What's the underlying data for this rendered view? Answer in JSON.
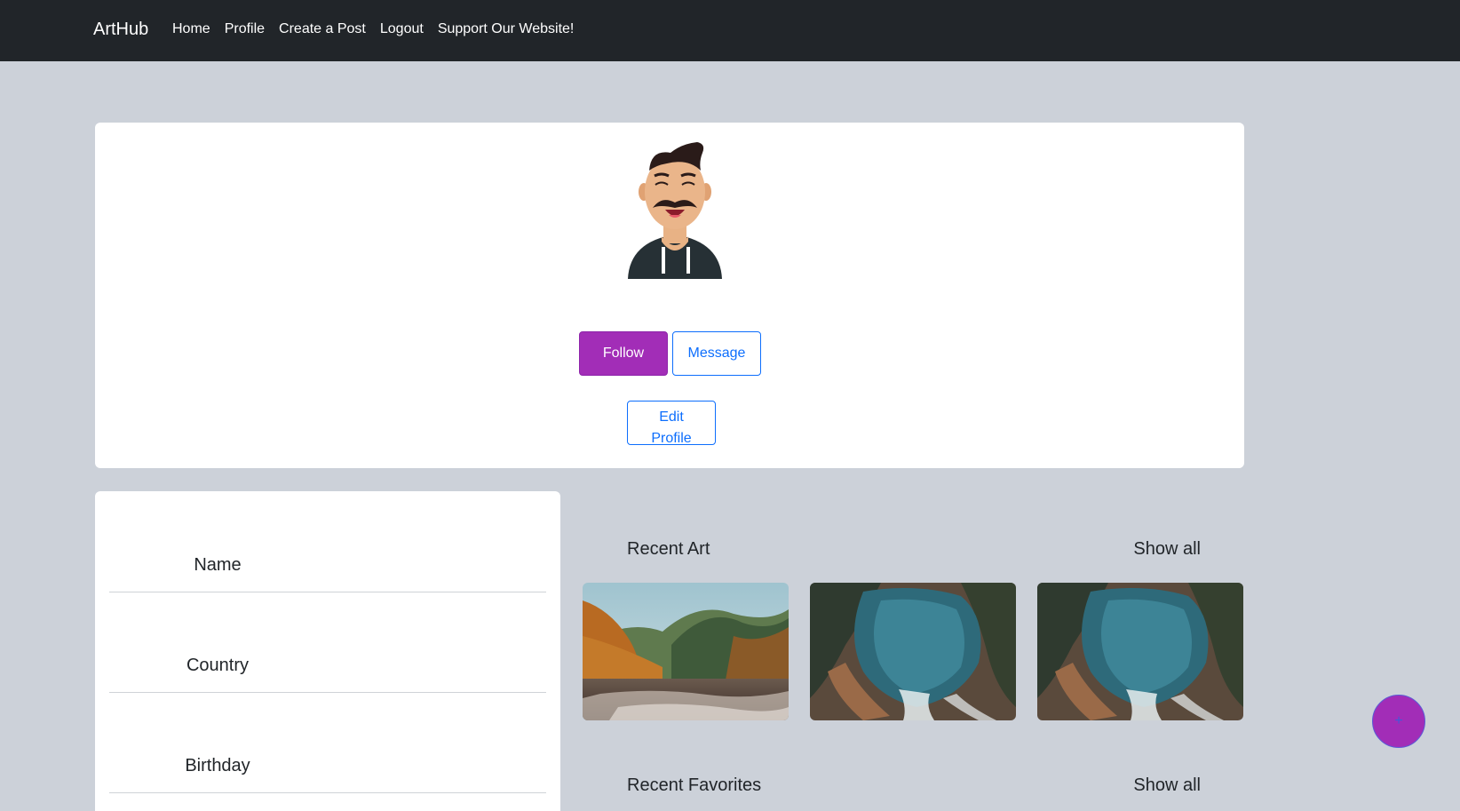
{
  "navbar": {
    "brand": "ArtHub",
    "links": [
      "Home",
      "Profile",
      "Create a Post",
      "Logout",
      "Support Our Website!"
    ]
  },
  "profile": {
    "follow_label": "Follow",
    "message_label": "Message",
    "edit_label": "Edit Profile"
  },
  "info": {
    "rows": [
      "Name",
      "Country",
      "Birthday"
    ]
  },
  "recent_art": {
    "title": "Recent Art",
    "show_all": "Show all"
  },
  "recent_favorites": {
    "title": "Recent Favorites",
    "show_all": "Show all"
  },
  "fab": {
    "label": "+"
  },
  "colors": {
    "accent": "#a22db7",
    "primary": "#0d6efd",
    "navbar": "#212529",
    "page_bg": "#ccd1d9"
  }
}
